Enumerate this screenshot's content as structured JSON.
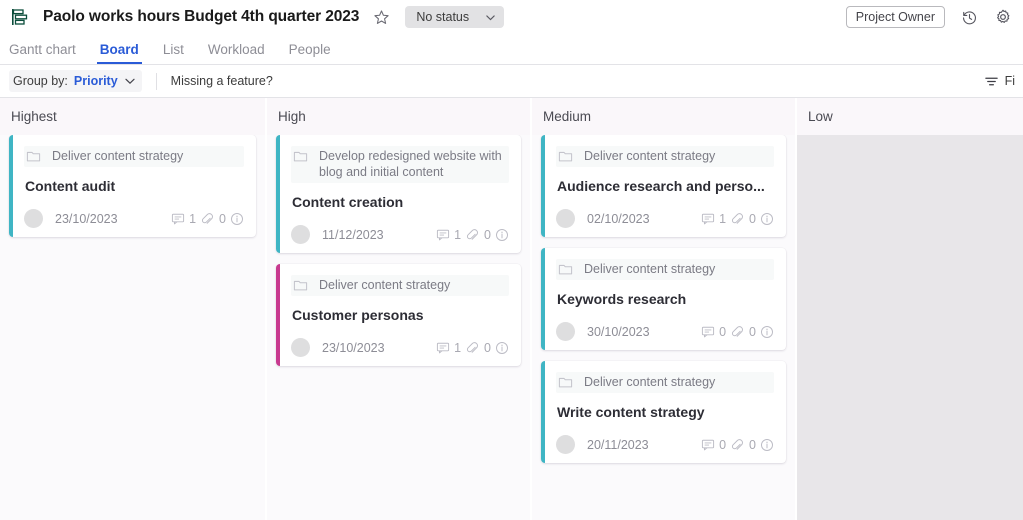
{
  "header": {
    "app_icon": "gantt-board-icon",
    "title": "Paolo works hours Budget 4th quarter 2023",
    "star_icon": "star-icon",
    "status": {
      "label": "No status",
      "chevron": "chevron-down-icon"
    },
    "owner_button": "Project Owner",
    "history_icon": "history-clock-icon",
    "settings_icon": "gear-icon"
  },
  "tabs": [
    {
      "label": "Gantt chart",
      "active": false
    },
    {
      "label": "Board",
      "active": true
    },
    {
      "label": "List",
      "active": false
    },
    {
      "label": "Workload",
      "active": false
    },
    {
      "label": "People",
      "active": false
    }
  ],
  "toolbar": {
    "group_by_label": "Group by:",
    "group_by_value": "Priority",
    "chevron": "chevron-down-icon",
    "missing_feature": "Missing a feature?",
    "filter_icon": "filter-icon",
    "filter_label": "Fi"
  },
  "colors": {
    "accent_teal": "#3fb5c4",
    "accent_magenta": "#c8398f",
    "tab_active": "#2a5bd7",
    "board_bg": "#faf7fa"
  },
  "columns": [
    {
      "title": "Highest",
      "cards": [
        {
          "parent": "Deliver content strategy",
          "title": "Content audit",
          "date": "23/10/2023",
          "comments": "1",
          "attachments": "0",
          "accent": "#3fb5c4"
        }
      ]
    },
    {
      "title": "High",
      "cards": [
        {
          "parent": "Develop redesigned website with blog and initial content",
          "title": "Content creation",
          "date": "11/12/2023",
          "comments": "1",
          "attachments": "0",
          "accent": "#3fb5c4"
        },
        {
          "parent": "Deliver content strategy",
          "title": "Customer personas",
          "date": "23/10/2023",
          "comments": "1",
          "attachments": "0",
          "accent": "#c8398f"
        }
      ]
    },
    {
      "title": "Medium",
      "cards": [
        {
          "parent": "Deliver content strategy",
          "title": "Audience research and perso...",
          "date": "02/10/2023",
          "comments": "1",
          "attachments": "0",
          "accent": "#3fb5c4"
        },
        {
          "parent": "Deliver content strategy",
          "title": "Keywords research",
          "date": "30/10/2023",
          "comments": "0",
          "attachments": "0",
          "accent": "#3fb5c4"
        },
        {
          "parent": "Deliver content strategy",
          "title": "Write content strategy",
          "date": "20/11/2023",
          "comments": "0",
          "attachments": "0",
          "accent": "#3fb5c4"
        }
      ]
    },
    {
      "title": "Low",
      "cards": []
    }
  ]
}
